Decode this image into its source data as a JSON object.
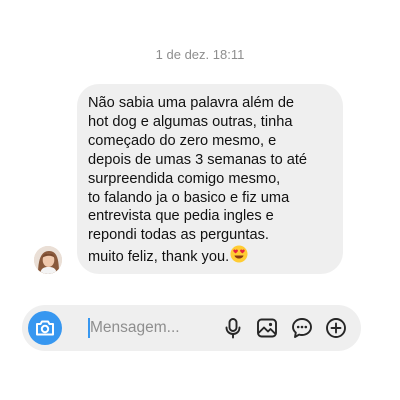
{
  "thread": {
    "timestamp": "1 de dez. 18:11"
  },
  "message": {
    "sender_avatar": "avatar-photo",
    "lines": [
      "Não sabia uma palavra além de",
      "hot dog e algumas outras, tinha",
      "começado do zero mesmo, e",
      "depois de umas 3 semanas to até",
      "surpreendida comigo mesmo,",
      "to falando ja o basico e fiz  uma",
      "entrevista que pedia ingles e",
      "repondi todas as perguntas.",
      "muito feliz, thank you."
    ],
    "emoji": "heart-eyes-emoji",
    "bubble_color": "#efefef"
  },
  "composer": {
    "placeholder": "Mensagem...",
    "camera_icon": "camera-icon",
    "accent_color": "#3797f0",
    "actions": [
      "microphone-icon",
      "image-icon",
      "sticker-icon",
      "plus-icon"
    ]
  }
}
